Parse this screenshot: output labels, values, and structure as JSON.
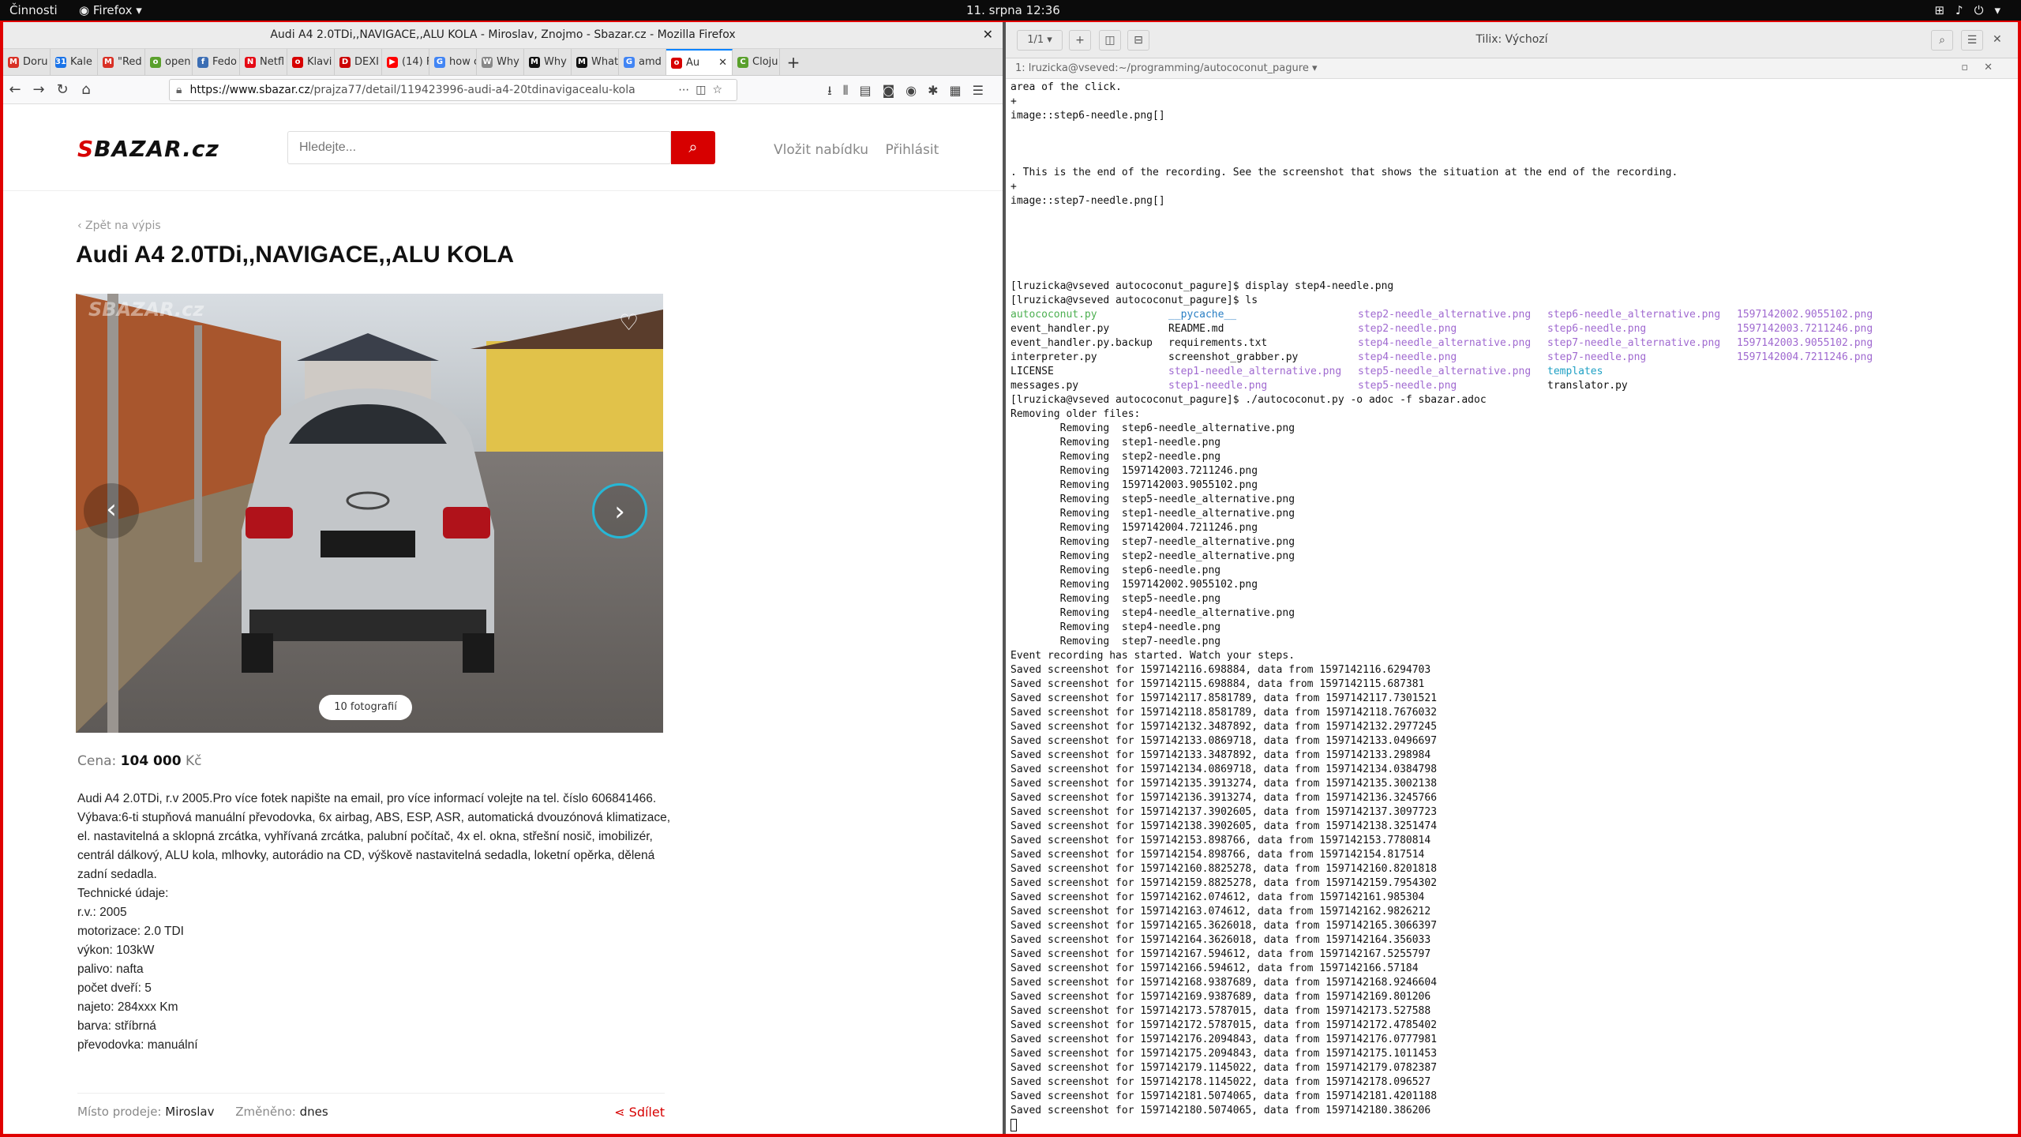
{
  "topbar": {
    "activities": "Činnosti",
    "app": "Firefox ▾",
    "clock": "11. srpna 12:36"
  },
  "firefox": {
    "window_title": "Audi A4 2.0TDi,,NAVIGACE,,ALU KOLA - Miroslav, Znojmo - Sbazar.cz - Mozilla Firefox",
    "tabs": [
      {
        "label": "Doru",
        "color": "#d93025",
        "glyph": "M"
      },
      {
        "label": "Kale",
        "color": "#1a73e8",
        "glyph": "31"
      },
      {
        "label": "\"Red",
        "color": "#d93025",
        "glyph": "M"
      },
      {
        "label": "open",
        "color": "#5aa02c",
        "glyph": "o"
      },
      {
        "label": "Fedo",
        "color": "#3c6eb4",
        "glyph": "f"
      },
      {
        "label": "Netfl",
        "color": "#e50914",
        "glyph": "N"
      },
      {
        "label": "Klavi",
        "color": "#d70000",
        "glyph": "o"
      },
      {
        "label": "DEXI",
        "color": "#c00",
        "glyph": "D"
      },
      {
        "label": "(14) F",
        "color": "#ff0000",
        "glyph": "▶"
      },
      {
        "label": "how c",
        "color": "#4285f4",
        "glyph": "G"
      },
      {
        "label": "Why",
        "color": "#888",
        "glyph": "W"
      },
      {
        "label": "Why",
        "color": "#111",
        "glyph": "M"
      },
      {
        "label": "What",
        "color": "#111",
        "glyph": "M"
      },
      {
        "label": "amd",
        "color": "#4285f4",
        "glyph": "G"
      }
    ],
    "active_tab": {
      "label": "Au",
      "color": "#d70000",
      "glyph": "o"
    },
    "last_tab": {
      "label": "Cloju",
      "color": "#5aa02c",
      "glyph": "C"
    },
    "url_host": "https://www.sbazar.cz",
    "url_path": "/prajza77/detail/119423996-audi-a4-20tdinavigacealu-kola"
  },
  "site": {
    "logo_s": "S",
    "logo_rest": "BAZAR.cz",
    "search_placeholder": "Hledejte...",
    "link_add": "Vložit nabídku",
    "link_login": "Přihlásit",
    "back": "‹ Zpět na výpis",
    "title": "Audi A4 2.0TDi,,NAVIGACE,,ALU KOLA",
    "watermark": "SBAZAR.cz",
    "photo_count": "10 fotografií",
    "price_label": "Cena:",
    "price_value": "104 000",
    "price_currency": "Kč",
    "description": [
      "Audi A4 2.0TDi, r.v 2005.Pro více fotek napište na email, pro více informací volejte na tel. číslo 606841466.",
      "Výbava:6-ti stupňová manuální převodovka, 6x airbag, ABS, ESP, ASR, automatická dvouzónová klimatizace, el. nastavitelná a sklopná zrcátka, vyhřívaná zrcátka, palubní počítač, 4x el. okna, střešní nosič, imobilizér, centrál dálkový, ALU kola, mlhovky, autorádio na CD, výškově nastavitelná sedadla, loketní opěrka, dělená zadní sedadla.",
      "Technické údaje:",
      "r.v.: 2005",
      "motorizace: 2.0 TDI",
      "výkon: 103kW",
      "palivo: nafta",
      "počet dveří: 5",
      "najeto: 284xxx Km",
      "barva: stříbrná",
      "převodovka: manuální"
    ],
    "place_label": "Místo prodeje:",
    "place_value": "Miroslav",
    "changed_label": "Změněno:",
    "changed_value": "dnes",
    "share": "Sdílet"
  },
  "tilix": {
    "session": "1/1 ▾",
    "title": "Tilix: Výchozí",
    "terminal_title": "1: lruzicka@vseved:~/programming/autococonut_pagure ▾",
    "lines_top": [
      "area of the click.",
      "+",
      "image::step6-needle.png[]",
      "",
      "",
      "",
      ". This is the end of the recording. See the screenshot that shows the situation at the end of the recording.",
      "+",
      "image::step7-needle.png[]",
      "",
      "",
      "",
      "",
      "",
      "[lruzicka@vseved autococonut_pagure]$ display step4-needle.png",
      "[lruzicka@vseved autococonut_pagure]$ ls"
    ],
    "ls_rows": [
      [
        [
          "autococonut.py",
          "green"
        ],
        [
          "__pycache__",
          "blue"
        ],
        [
          "step2-needle_alternative.png",
          "mag"
        ],
        [
          "step6-needle_alternative.png",
          "mag"
        ],
        [
          "1597142002.9055102.png",
          "mag"
        ]
      ],
      [
        [
          "event_handler.py",
          ""
        ],
        [
          "README.md",
          ""
        ],
        [
          "step2-needle.png",
          "mag"
        ],
        [
          "step6-needle.png",
          "mag"
        ],
        [
          "1597142003.7211246.png",
          "mag"
        ]
      ],
      [
        [
          "event_handler.py.backup",
          ""
        ],
        [
          "requirements.txt",
          ""
        ],
        [
          "step4-needle_alternative.png",
          "mag"
        ],
        [
          "step7-needle_alternative.png",
          "mag"
        ],
        [
          "1597142003.9055102.png",
          "mag"
        ]
      ],
      [
        [
          "interpreter.py",
          ""
        ],
        [
          "screenshot_grabber.py",
          ""
        ],
        [
          "step4-needle.png",
          "mag"
        ],
        [
          "step7-needle.png",
          "mag"
        ],
        [
          "1597142004.7211246.png",
          "mag"
        ]
      ],
      [
        [
          "LICENSE",
          ""
        ],
        [
          "step1-needle_alternative.png",
          "mag"
        ],
        [
          "step5-needle_alternative.png",
          "mag"
        ],
        [
          "templates",
          "cyan"
        ],
        [
          "",
          ""
        ]
      ],
      [
        [
          "messages.py",
          ""
        ],
        [
          "step1-needle.png",
          "mag"
        ],
        [
          "step5-needle.png",
          "mag"
        ],
        [
          "translator.py",
          ""
        ],
        [
          "",
          ""
        ]
      ]
    ],
    "lines_bottom": [
      "[lruzicka@vseved autococonut_pagure]$ ./autococonut.py -o adoc -f sbazar.adoc",
      "Removing older files:",
      "        Removing  step6-needle_alternative.png",
      "        Removing  step1-needle.png",
      "        Removing  step2-needle.png",
      "        Removing  1597142003.7211246.png",
      "        Removing  1597142003.9055102.png",
      "        Removing  step5-needle_alternative.png",
      "        Removing  step1-needle_alternative.png",
      "        Removing  1597142004.7211246.png",
      "        Removing  step7-needle_alternative.png",
      "        Removing  step2-needle_alternative.png",
      "        Removing  step6-needle.png",
      "        Removing  1597142002.9055102.png",
      "        Removing  step5-needle.png",
      "        Removing  step4-needle_alternative.png",
      "        Removing  step4-needle.png",
      "        Removing  step7-needle.png",
      "Event recording has started. Watch your steps.",
      "Saved screenshot for 1597142116.698884, data from 1597142116.6294703",
      "Saved screenshot for 1597142115.698884, data from 1597142115.687381",
      "Saved screenshot for 1597142117.8581789, data from 1597142117.7301521",
      "Saved screenshot for 1597142118.8581789, data from 1597142118.7676032",
      "Saved screenshot for 1597142132.3487892, data from 1597142132.2977245",
      "Saved screenshot for 1597142133.0869718, data from 1597142133.0496697",
      "Saved screenshot for 1597142133.3487892, data from 1597142133.298984",
      "Saved screenshot for 1597142134.0869718, data from 1597142134.0384798",
      "Saved screenshot for 1597142135.3913274, data from 1597142135.3002138",
      "Saved screenshot for 1597142136.3913274, data from 1597142136.3245766",
      "Saved screenshot for 1597142137.3902605, data from 1597142137.3097723",
      "Saved screenshot for 1597142138.3902605, data from 1597142138.3251474",
      "Saved screenshot for 1597142153.898766, data from 1597142153.7780814",
      "Saved screenshot for 1597142154.898766, data from 1597142154.817514",
      "Saved screenshot for 1597142160.8825278, data from 1597142160.8201818",
      "Saved screenshot for 1597142159.8825278, data from 1597142159.7954302",
      "Saved screenshot for 1597142162.074612, data from 1597142161.985304",
      "Saved screenshot for 1597142163.074612, data from 1597142162.9826212",
      "Saved screenshot for 1597142165.3626018, data from 1597142165.3066397",
      "Saved screenshot for 1597142164.3626018, data from 1597142164.356033",
      "Saved screenshot for 1597142167.594612, data from 1597142167.5255797",
      "Saved screenshot for 1597142166.594612, data from 1597142166.57184",
      "Saved screenshot for 1597142168.9387689, data from 1597142168.9246604",
      "Saved screenshot for 1597142169.9387689, data from 1597142169.801206",
      "Saved screenshot for 1597142173.5787015, data from 1597142173.527588",
      "Saved screenshot for 1597142172.5787015, data from 1597142172.4785402",
      "Saved screenshot for 1597142176.2094843, data from 1597142176.0777981",
      "Saved screenshot for 1597142175.2094843, data from 1597142175.1011453",
      "Saved screenshot for 1597142179.1145022, data from 1597142179.0782387",
      "Saved screenshot for 1597142178.1145022, data from 1597142178.096527",
      "Saved screenshot for 1597142181.5074065, data from 1597142181.4201188",
      "Saved screenshot for 1597142180.5074065, data from 1597142180.386206"
    ]
  }
}
